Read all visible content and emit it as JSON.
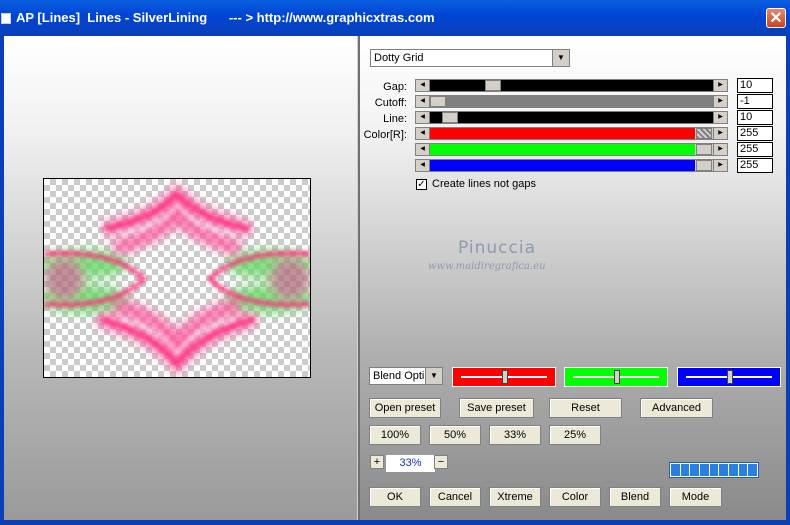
{
  "window": {
    "title": "AP [Lines]  Lines - SilverLining      --- > http://www.graphicxtras.com",
    "close_glyph": "✕"
  },
  "preset_select": {
    "value": "Dotty Grid"
  },
  "params": [
    {
      "label": "Gap:",
      "value": "10",
      "color": "#000000",
      "level": 0.2
    },
    {
      "label": "Cutoff:",
      "value": "-1",
      "color": "#808080",
      "level": 0.0
    },
    {
      "label": "Line:",
      "value": "10",
      "color": "#000000",
      "level": 0.02
    },
    {
      "label": "Color[R]:",
      "value": "255",
      "color": "#ff0000",
      "level": 1.0
    },
    {
      "label": "",
      "value": "255",
      "color": "#00ff00",
      "level": 1.0
    },
    {
      "label": "",
      "value": "255",
      "color": "#0000ff",
      "level": 1.0
    }
  ],
  "create_lines": {
    "label": "Create lines not gaps",
    "checked": true
  },
  "watermark": {
    "name": "Pinuccia",
    "url": "www.maidiregrafica.eu"
  },
  "blend_select": {
    "value": "Blend Opti"
  },
  "color_sliders": [
    {
      "color": "#ff0000",
      "level": 0.5
    },
    {
      "color": "#00ff00",
      "level": 0.5
    },
    {
      "color": "#0000ff",
      "level": 0.5
    }
  ],
  "buttons_row1": {
    "open": "Open preset",
    "save": "Save preset",
    "reset": "Reset",
    "advanced": "Advanced"
  },
  "zoom_buttons": {
    "z100": "100%",
    "z50": "50%",
    "z33": "33%",
    "z25": "25%"
  },
  "zoom": {
    "plus": "+",
    "value": "33%",
    "minus": "−"
  },
  "bottom_buttons": {
    "ok": "OK",
    "cancel": "Cancel",
    "xtreme": "Xtreme",
    "color": "Color",
    "blend": "Blend",
    "mode": "Mode"
  }
}
